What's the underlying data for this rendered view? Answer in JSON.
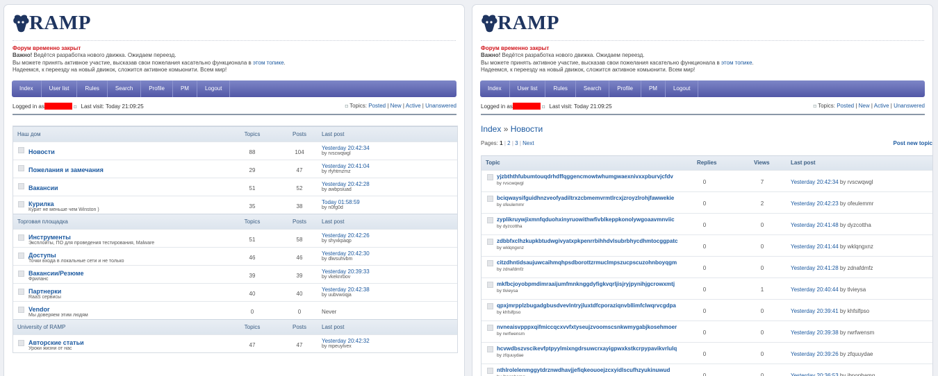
{
  "brand": {
    "logo_text": "RAMP"
  },
  "notice": {
    "closed": "Форум временно закрыт",
    "important_label": "Важно!",
    "line1": "Ведётся разработка нового движка. Ожидаем переезд.",
    "line2_prefix": "Вы можете принять активное участие, высказав свои пожелания касательно функционала в",
    "line2_link": "этом топике",
    "line2_suffix": ".",
    "line3": "Надеемся, к переезду на новый движок, сложится активное комьюнити. Всем мир!"
  },
  "nav": [
    "Index",
    "User list",
    "Rules",
    "Search",
    "Profile",
    "PM",
    "Logout"
  ],
  "status": {
    "logged_in_as": "Logged in as",
    "last_visit": "Last visit: Today 21:09:25",
    "topics_label": "Topics:",
    "links": [
      "Posted",
      "New",
      "Active",
      "Unanswered"
    ]
  },
  "forum_index": {
    "categories": [
      {
        "name": "Наш дом",
        "headers": {
          "topics": "Topics",
          "posts": "Posts",
          "last": "Last post"
        },
        "forums": [
          {
            "name": "Новости",
            "desc": "",
            "topics": "88",
            "posts": "104",
            "last_time": "Yesterday 20:42:34",
            "last_by": "by rvscwqwgl"
          },
          {
            "name": "Пожелания и замечания",
            "desc": "",
            "topics": "29",
            "posts": "47",
            "last_time": "Yesterday 20:41:04",
            "last_by": "by rfyhtmzmz"
          },
          {
            "name": "Вакансии",
            "desc": "",
            "topics": "51",
            "posts": "52",
            "last_time": "Yesterday 20:42:28",
            "last_by": "by awbpsiuad"
          },
          {
            "name": "Курилка",
            "desc": "Курит не меньше чем Winston )",
            "topics": "35",
            "posts": "38",
            "last_time": "Today 01:58:59",
            "last_by": "by n0fg0d"
          }
        ]
      },
      {
        "name": "Торговая площадка",
        "headers": {
          "topics": "Topics",
          "posts": "Posts",
          "last": "Last post"
        },
        "forums": [
          {
            "name": "Инструменты",
            "desc": "Эксплойты, ПО для проведения тестирования, Malware",
            "topics": "51",
            "posts": "58",
            "last_time": "Yesterday 20:42:26",
            "last_by": "by shyxkpaqp"
          },
          {
            "name": "Доступы",
            "desc": "Точки входа в локальные сети и не только",
            "topics": "46",
            "posts": "46",
            "last_time": "Yesterday 20:42:30",
            "last_by": "by dlwsuhvbm"
          },
          {
            "name": "Вакансии/Резюме",
            "desc": "Фриланс",
            "topics": "39",
            "posts": "39",
            "last_time": "Yesterday 20:39:33",
            "last_by": "by vkeknrbov"
          },
          {
            "name": "Партнерки",
            "desc": "RaaS сервисы",
            "topics": "40",
            "posts": "40",
            "last_time": "Yesterday 20:42:38",
            "last_by": "by uubvwoqja"
          },
          {
            "name": "Vendor",
            "desc": "Мы доверяем этим людям",
            "topics": "0",
            "posts": "0",
            "never": "Never"
          }
        ]
      },
      {
        "name": "University of RAMP",
        "headers": {
          "topics": "Topics",
          "posts": "Posts",
          "last": "Last post"
        },
        "forums": [
          {
            "name": "Авторские статьи",
            "desc": "Уроки жизни от нас",
            "topics": "47",
            "posts": "47",
            "last_time": "Yesterday 20:42:32",
            "last_by": "by mpeuylvex"
          }
        ]
      }
    ]
  },
  "topic_view": {
    "crumb_root": "Index",
    "crumb_sep": "»",
    "crumb_forum": "Новости",
    "pages_label": "Pages:",
    "pages": [
      "1",
      "2",
      "3"
    ],
    "next": "Next",
    "post_new_topic": "Post new topic",
    "headers": {
      "topic": "Topic",
      "replies": "Replies",
      "views": "Views",
      "last": "Last post"
    },
    "topics": [
      {
        "title": "yjzbththfubumtouqdrhdffqggencmowtwhumgwaexnivxxpburvjcfdv",
        "by": "by rvscwqwgl",
        "replies": "0",
        "views": "7",
        "last_time": "Yesterday 20:42:34",
        "last_by": "by rvscwqwgl"
      },
      {
        "title": "bciqwaysifguidhnzveofyadiltrxzcbmemvrmtlrcxjzroyzlrohjfawwekie",
        "by": "by ofeulemmr",
        "replies": "0",
        "views": "2",
        "last_time": "Yesterday 20:42:23",
        "last_by": "by ofeulemmr"
      },
      {
        "title": "zyplikruywjixmnfqduohxinyruowithwfivblkeppkonolywgoaavmnviic",
        "by": "by dyzcottha",
        "replies": "0",
        "views": "0",
        "last_time": "Yesterday 20:41:48",
        "last_by": "by dyzcottha"
      },
      {
        "title": "zdbbfxclhzkupkbtudwgivyatxpkpenrrbihhdvlsubrbhycdhmtocggpatc",
        "by": "by wklqngxnz",
        "replies": "0",
        "views": "0",
        "last_time": "Yesterday 20:41:44",
        "last_by": "by wklqngxnz"
      },
      {
        "title": "citzdhntidsaujuwcaihmqhpsdborottzrmuclmpszucpscuzohnboyqgm",
        "by": "by zdnafdmfz",
        "replies": "0",
        "views": "0",
        "last_time": "Yesterday 20:41:28",
        "last_by": "by zdnafdmfz"
      },
      {
        "title": "mkfbcjoyobpmdimraaijumfmnknggdyfigkvqrljisjryjpynihjgcrowxmtj",
        "by": "by tlvieysa",
        "replies": "0",
        "views": "1",
        "last_time": "Yesterday 20:40:44",
        "last_by": "by tlvieysa"
      },
      {
        "title": "qpxjmrpplzbugadgbusdvevlntryjluxtdfcporaziqnvbllimfclwqrvcgdpa",
        "by": "by khfslfpso",
        "replies": "0",
        "views": "0",
        "last_time": "Yesterday 20:39:41",
        "last_by": "by khfslfpso"
      },
      {
        "title": "nvneaisvpppxqifmiccqcxvvfxtyseujzvoomscsnkwmygabjkosehmoer",
        "by": "by rwrfwensm",
        "replies": "0",
        "views": "0",
        "last_time": "Yesterday 20:39:38",
        "last_by": "by rwrfwensm"
      },
      {
        "title": "hcvwdbszvscikevfptpyylmixngdrsuwcrxayigpwxkstkcrpypavikvrlulq",
        "by": "by zfquuydae",
        "replies": "0",
        "views": "0",
        "last_time": "Yesterday 20:39:26",
        "last_by": "by zfquuydae"
      },
      {
        "title": "nthlrolelenmggytdrznwdhavjjefiqkeouoejzcxyidlscufhzyukinuwud",
        "by": "by ibnopbamq",
        "replies": "0",
        "views": "0",
        "last_time": "Yesterday 20:36:53",
        "last_by": "by ibnopbamq"
      }
    ]
  }
}
